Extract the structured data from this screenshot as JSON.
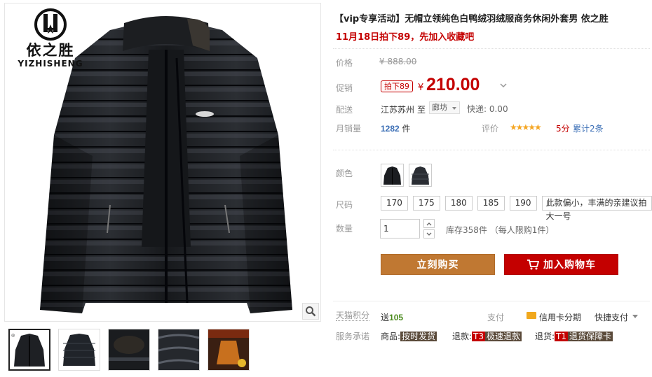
{
  "brand": {
    "name_cn": "依之胜",
    "name_en": "YIZHISHENG"
  },
  "product": {
    "title": "【vip专享活动】无帽立领纯色白鸭绒羽绒服商务休闲外套男 依之胜",
    "subtitle": "11月18日拍下89，先加入收藏吧"
  },
  "price": {
    "label": "价格",
    "original": "¥ 888.00"
  },
  "promo": {
    "label": "促销",
    "tag": "拍下89",
    "yen": "¥",
    "price": "210.00"
  },
  "shipping": {
    "label": "配送",
    "from": "江苏苏州",
    "to_text": "至",
    "to_city": "廊坊",
    "fee": "快递: 0.00"
  },
  "sales": {
    "label": "月销量",
    "count": "1282",
    "unit": "件",
    "rating_label": "评价",
    "stars": "★★★★★",
    "score": "5分",
    "reviews": "累计2条"
  },
  "color": {
    "label": "颜色"
  },
  "size": {
    "label": "尺码",
    "options": [
      "170",
      "175",
      "180",
      "185",
      "190"
    ],
    "note": "此款偏小，丰满的亲建议拍大一号"
  },
  "quantity": {
    "label": "数量",
    "value": "1",
    "stock": "库存358件 （每人限购1件）"
  },
  "buttons": {
    "buy_now": "立刻购买",
    "add_cart": "加入购物车"
  },
  "points": {
    "label": "天猫积分",
    "send_text": "送",
    "value": "105"
  },
  "payment": {
    "label": "支付",
    "credit": "信用卡分期",
    "quick": "快捷支付"
  },
  "service": {
    "label": "服务承诺",
    "goods_label": "商品:",
    "goods_tag": "按时发货",
    "refund_label": "退款:",
    "refund_code": "T3",
    "refund_tag": "极速退款",
    "return_label": "退货:",
    "return_code": "T1",
    "return_tag": "退货保障卡"
  },
  "colors": {
    "accent_red": "#c40000",
    "buy_orange": "#c07832",
    "link_blue": "#3c6fb6",
    "points_green": "#4a8a1c",
    "star_gold": "#f5a623"
  }
}
